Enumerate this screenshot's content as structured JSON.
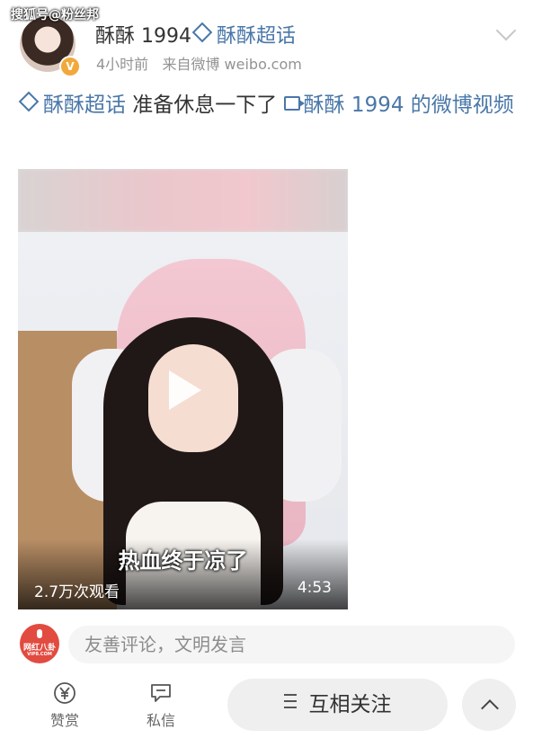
{
  "watermark": "搜狐号@粉丝邦",
  "post": {
    "author": "酥酥 1994",
    "topic_badge": "酥酥超话",
    "time": "4小时前",
    "source": "来自微博 weibo.com",
    "text_topic": "酥酥超话",
    "text_body": " 准备休息一下了 ",
    "text_video_link": "酥酥 1994 的微博视频"
  },
  "video": {
    "subtitle": "热血终于凉了",
    "views": "2.7万次观看",
    "duration": "4:53"
  },
  "comment": {
    "avatar_label": "网红八卦",
    "avatar_sub": "VIP8.COM",
    "placeholder": "友善评论，文明发言"
  },
  "footer": {
    "reward_label": "赞赏",
    "message_label": "私信",
    "follow_label": "互相关注"
  },
  "colors": {
    "link": "#4a77a8",
    "verified": "#f2a93b",
    "comment_avatar": "#e24b40"
  }
}
